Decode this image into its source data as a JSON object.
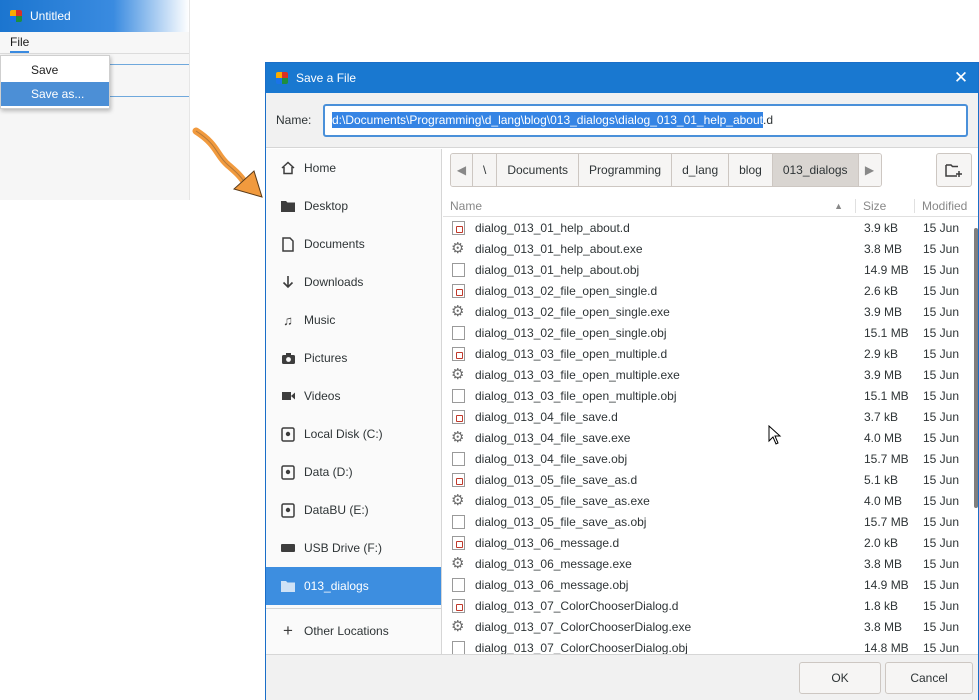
{
  "app": {
    "title": "Untitled",
    "menu": "File",
    "file_menu_items": [
      "Save",
      "Save as..."
    ]
  },
  "dialog": {
    "title": "Save a File",
    "name_label": "Name:",
    "name_value_selected": "d:\\Documents\\Programming\\d_lang\\blog\\013_dialogs\\dialog_013_01_help_about",
    "name_value_rest": ".d",
    "sidebar": [
      {
        "label": "Home",
        "icon": "home-icon"
      },
      {
        "label": "Desktop",
        "icon": "folder-icon"
      },
      {
        "label": "Documents",
        "icon": "document-icon"
      },
      {
        "label": "Downloads",
        "icon": "download-icon"
      },
      {
        "label": "Music",
        "icon": "music-icon"
      },
      {
        "label": "Pictures",
        "icon": "camera-icon"
      },
      {
        "label": "Videos",
        "icon": "video-icon"
      },
      {
        "label": "Local Disk (C:)",
        "icon": "drive-icon"
      },
      {
        "label": "Data (D:)",
        "icon": "drive-icon"
      },
      {
        "label": "DataBU (E:)",
        "icon": "drive-icon"
      },
      {
        "label": "USB Drive (F:)",
        "icon": "usb-drive-icon"
      },
      {
        "label": "013_dialogs",
        "icon": "folder-icon",
        "active": true
      }
    ],
    "other_locations": "Other Locations",
    "path": [
      "\\",
      "Documents",
      "Programming",
      "d_lang",
      "blog",
      "013_dialogs"
    ],
    "columns": {
      "name": "Name",
      "size": "Size",
      "modified": "Modified"
    },
    "files": [
      {
        "name": "dialog_013_01_help_about.d",
        "size": "3.9 kB",
        "modified": "15 Jun",
        "type": "src"
      },
      {
        "name": "dialog_013_01_help_about.exe",
        "size": "3.8 MB",
        "modified": "15 Jun",
        "type": "exe"
      },
      {
        "name": "dialog_013_01_help_about.obj",
        "size": "14.9 MB",
        "modified": "15 Jun",
        "type": "doc"
      },
      {
        "name": "dialog_013_02_file_open_single.d",
        "size": "2.6 kB",
        "modified": "15 Jun",
        "type": "src"
      },
      {
        "name": "dialog_013_02_file_open_single.exe",
        "size": "3.9 MB",
        "modified": "15 Jun",
        "type": "exe"
      },
      {
        "name": "dialog_013_02_file_open_single.obj",
        "size": "15.1 MB",
        "modified": "15 Jun",
        "type": "doc"
      },
      {
        "name": "dialog_013_03_file_open_multiple.d",
        "size": "2.9 kB",
        "modified": "15 Jun",
        "type": "src"
      },
      {
        "name": "dialog_013_03_file_open_multiple.exe",
        "size": "3.9 MB",
        "modified": "15 Jun",
        "type": "exe"
      },
      {
        "name": "dialog_013_03_file_open_multiple.obj",
        "size": "15.1 MB",
        "modified": "15 Jun",
        "type": "doc"
      },
      {
        "name": "dialog_013_04_file_save.d",
        "size": "3.7 kB",
        "modified": "15 Jun",
        "type": "src"
      },
      {
        "name": "dialog_013_04_file_save.exe",
        "size": "4.0 MB",
        "modified": "15 Jun",
        "type": "exe"
      },
      {
        "name": "dialog_013_04_file_save.obj",
        "size": "15.7 MB",
        "modified": "15 Jun",
        "type": "doc"
      },
      {
        "name": "dialog_013_05_file_save_as.d",
        "size": "5.1 kB",
        "modified": "15 Jun",
        "type": "src"
      },
      {
        "name": "dialog_013_05_file_save_as.exe",
        "size": "4.0 MB",
        "modified": "15 Jun",
        "type": "exe"
      },
      {
        "name": "dialog_013_05_file_save_as.obj",
        "size": "15.7 MB",
        "modified": "15 Jun",
        "type": "doc"
      },
      {
        "name": "dialog_013_06_message.d",
        "size": "2.0 kB",
        "modified": "15 Jun",
        "type": "src"
      },
      {
        "name": "dialog_013_06_message.exe",
        "size": "3.8 MB",
        "modified": "15 Jun",
        "type": "exe"
      },
      {
        "name": "dialog_013_06_message.obj",
        "size": "14.9 MB",
        "modified": "15 Jun",
        "type": "doc"
      },
      {
        "name": "dialog_013_07_ColorChooserDialog.d",
        "size": "1.8 kB",
        "modified": "15 Jun",
        "type": "src"
      },
      {
        "name": "dialog_013_07_ColorChooserDialog.exe",
        "size": "3.8 MB",
        "modified": "15 Jun",
        "type": "exe"
      },
      {
        "name": "dialog_013_07_ColorChooserDialog.obj",
        "size": "14.8 MB",
        "modified": "15 Jun",
        "type": "doc"
      }
    ],
    "ok_label": "OK",
    "cancel_label": "Cancel"
  }
}
